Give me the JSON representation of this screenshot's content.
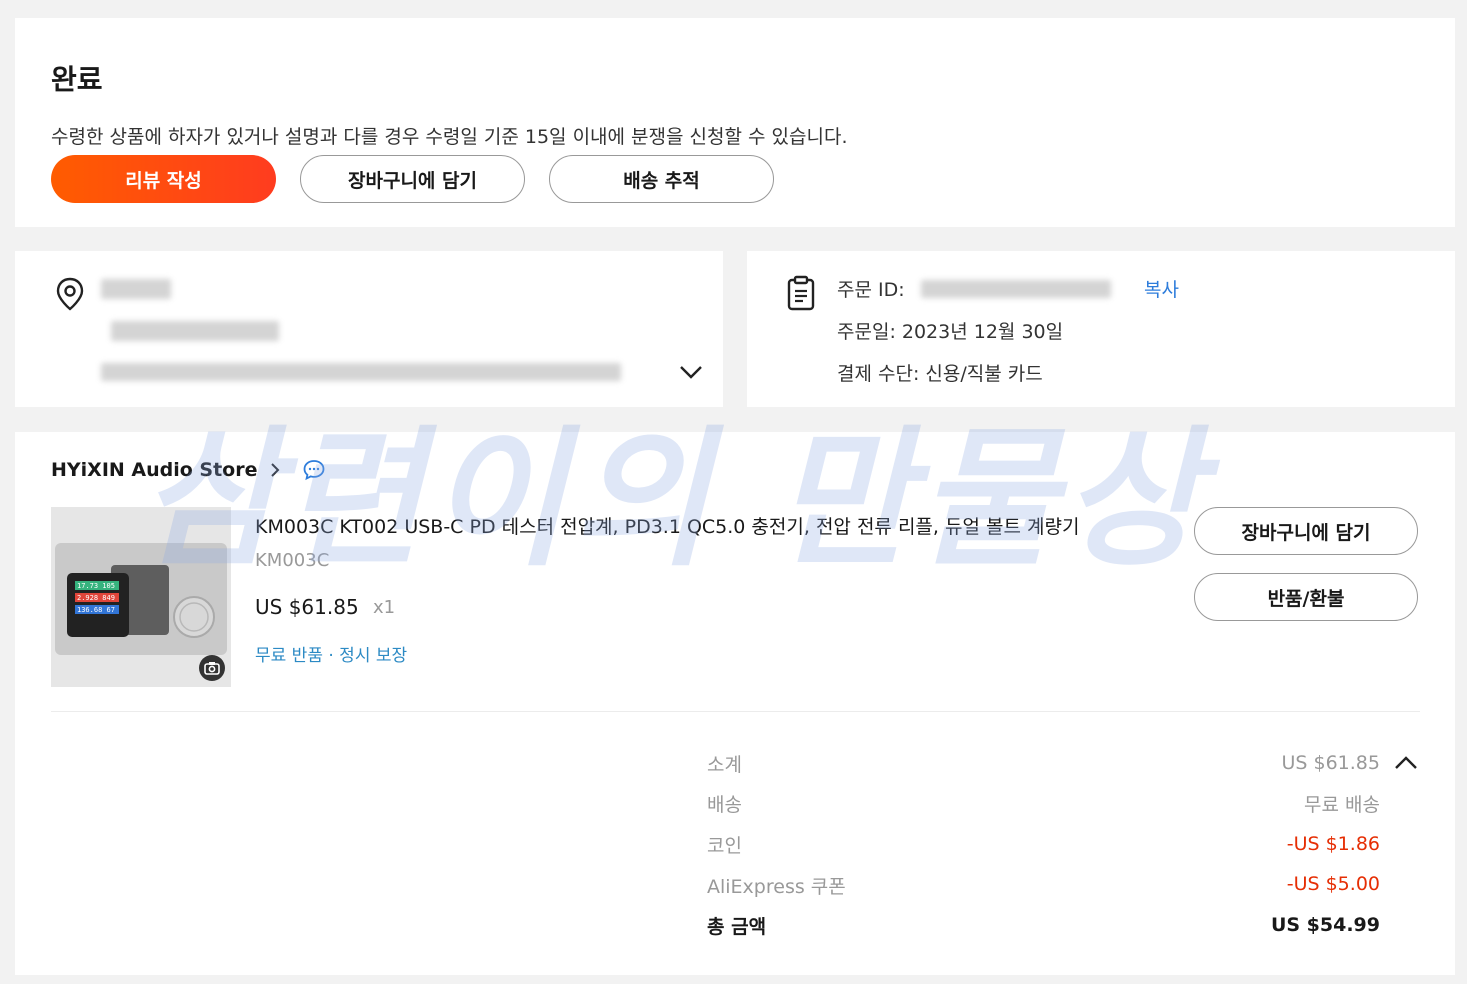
{
  "status": {
    "title": "완료",
    "description": "수령한 상품에 하자가 있거나 설명과 다를 경우 수령일 기준 15일 이내에 분쟁을 신청할 수 있습니다.",
    "buttons": {
      "review": "리뷰 작성",
      "add_to_cart": "장바구니에 담기",
      "track": "배송 추적"
    }
  },
  "address": {
    "icon": "location-pin-icon",
    "expand_icon": "chevron-down-icon"
  },
  "order": {
    "id_label": "주문 ID:",
    "copy_label": "복사",
    "date_line": "주문일: 2023년 12월 30일",
    "payment_line": "결제 수단: 신용/직불 카드"
  },
  "store": {
    "name": "HYiXIN Audio Store"
  },
  "item": {
    "title": "KM003C KT002 USB-C PD 테스터 전압계, PD3.1 QC5.0 충전기, 전압 전류 리플, 듀얼 볼트 계량기",
    "sku": "KM003C",
    "price": "US $61.85",
    "qty": "x1",
    "services": "무료 반품 · 정시 보장",
    "screen_values": [
      "17.73 105",
      "2.928 849",
      "136.68 67"
    ],
    "buttons": {
      "add_to_cart": "장바구니에 담기",
      "return": "반품/환불"
    }
  },
  "summary": {
    "subtotal_label": "소계",
    "subtotal_value": "US $61.85",
    "shipping_label": "배송",
    "shipping_value": "무료 배송",
    "coins_label": "코인",
    "coins_value": "-US $1.86",
    "coupon_label": "AliExpress 쿠폰",
    "coupon_value": "-US $5.00",
    "total_label": "총 금액",
    "total_value": "US $54.99"
  },
  "watermark": "삼련이의 만물상",
  "colors": {
    "accent": "#ff4f0f",
    "link": "#2e7ddb",
    "discount": "#e62e04"
  }
}
